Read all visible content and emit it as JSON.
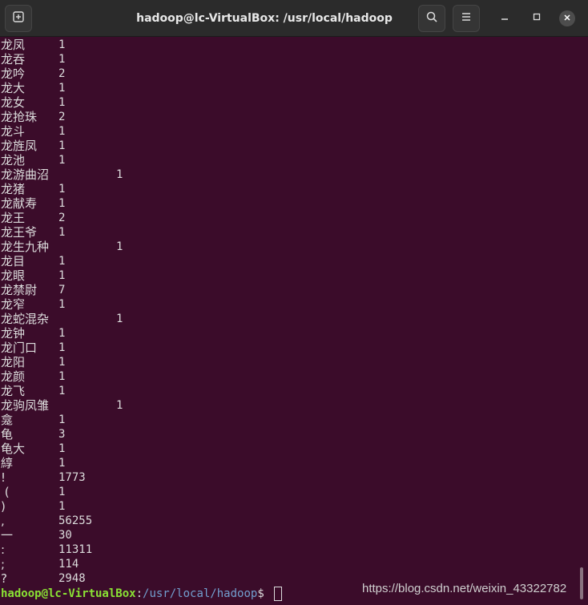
{
  "window": {
    "title": "hadoop@lc-VirtualBox: /usr/local/hadoop",
    "icons": {
      "new_tab": "new-tab-icon",
      "search": "search-icon",
      "menu": "hamburger-menu-icon",
      "minimize": "minimize-icon",
      "maximize": "maximize-icon",
      "close": "close-icon"
    }
  },
  "terminal": {
    "rows": [
      {
        "word": "龙凤",
        "count": "1"
      },
      {
        "word": "龙吞",
        "count": "1"
      },
      {
        "word": "龙吟",
        "count": "2"
      },
      {
        "word": "龙大",
        "count": "1"
      },
      {
        "word": "龙女",
        "count": "1"
      },
      {
        "word": "龙抢珠",
        "count": "2"
      },
      {
        "word": "龙斗",
        "count": "1"
      },
      {
        "word": "龙旌凤",
        "count": "1"
      },
      {
        "word": "龙池",
        "count": "1"
      },
      {
        "word": "龙游曲沼",
        "count": "1",
        "wide": true
      },
      {
        "word": "龙猪",
        "count": "1"
      },
      {
        "word": "龙献寿",
        "count": "1"
      },
      {
        "word": "龙王",
        "count": "2"
      },
      {
        "word": "龙王爷",
        "count": "1"
      },
      {
        "word": "龙生九种",
        "count": "1",
        "wide": true
      },
      {
        "word": "龙目",
        "count": "1"
      },
      {
        "word": "龙眼",
        "count": "1"
      },
      {
        "word": "龙禁尉",
        "count": "7"
      },
      {
        "word": "龙窄",
        "count": "1"
      },
      {
        "word": "龙蛇混杂",
        "count": "1",
        "wide": true
      },
      {
        "word": "龙钟",
        "count": "1"
      },
      {
        "word": "龙门口",
        "count": "1"
      },
      {
        "word": "龙阳",
        "count": "1"
      },
      {
        "word": "龙颜",
        "count": "1"
      },
      {
        "word": "龙飞",
        "count": "1"
      },
      {
        "word": "龙驹凤雏",
        "count": "1",
        "wide": true
      },
      {
        "word": "龛",
        "count": "1"
      },
      {
        "word": "龟",
        "count": "3"
      },
      {
        "word": "龟大",
        "count": "1"
      },
      {
        "word": "綧",
        "count": "1"
      },
      {
        "word": "!",
        "count": "1773"
      },
      {
        "word": " (",
        "count": "1"
      },
      {
        "word": ")",
        "count": "1"
      },
      {
        "word": ",",
        "count": "56255"
      },
      {
        "word": "一",
        "count": "30"
      },
      {
        "word": ":",
        "count": "11311"
      },
      {
        "word": ";",
        "count": "114"
      },
      {
        "word": "?",
        "count": "2948"
      }
    ]
  },
  "prompt": {
    "user_host": "hadoop@lc-VirtualBox",
    "colon": ":",
    "path": "/usr/local/hadoop",
    "symbol": "$ "
  },
  "watermark": "https://blog.csdn.net/weixin_43322782",
  "colors": {
    "background": "#3b0c2a",
    "titlebar": "#2b2b2b",
    "prompt_user": "#8ae234",
    "prompt_path": "#729fcf"
  }
}
